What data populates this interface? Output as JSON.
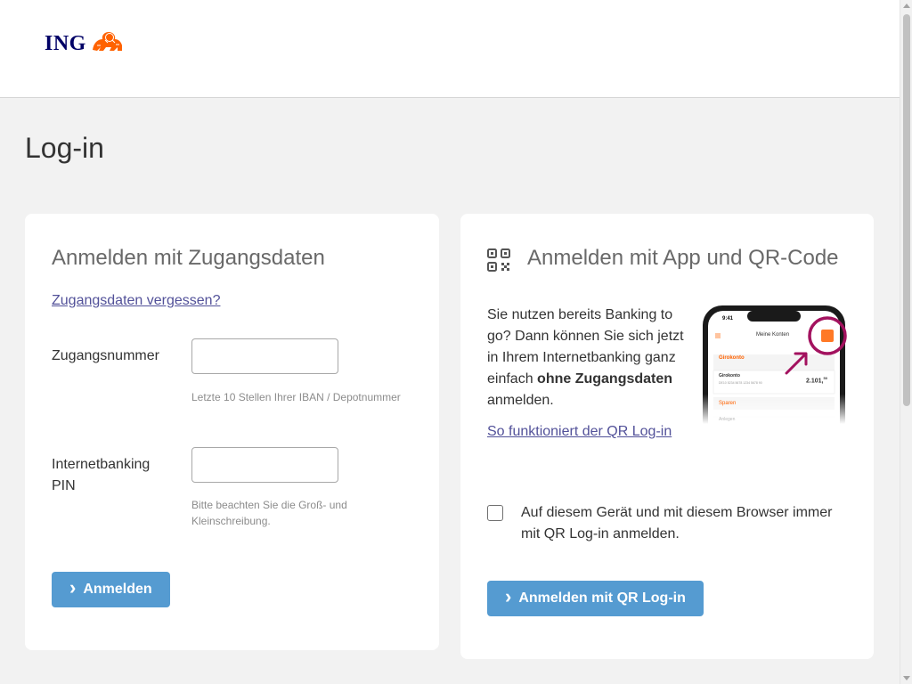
{
  "header": {
    "logo_text": "ING",
    "brand_color": "#000066",
    "lion_color": "#ff6200"
  },
  "page": {
    "title": "Log-in"
  },
  "credentials": {
    "title": "Anmelden mit Zugangsdaten",
    "forgot_link": "Zugangsdaten vergessen?",
    "access_number_label": "Zugangsnummer",
    "access_number_value": "",
    "access_number_hint": "Letzte 10 Stellen Ihrer IBAN / Depotnummer",
    "pin_label_line1": "Internetbanking",
    "pin_label_line2": "PIN",
    "pin_value": "",
    "pin_hint_line1": "Bitte beachten Sie die Groß- und",
    "pin_hint_line2": "Kleinschreibung.",
    "submit_label": "Anmelden"
  },
  "qr": {
    "title": "Anmelden mit App und QR-Code",
    "text_line1": "Sie nutzen bereits Banking to",
    "text_line2": "go? Dann können Sie sich jetzt",
    "text_line3": "in Ihrem Internetbanking ganz",
    "text_line4_prefix": "einfach ",
    "text_line4_bold": "ohne Zugangsdaten",
    "text_line5": "anmelden.",
    "how_link": "So funktioniert der QR Log-in",
    "checkbox_line1": "Auf diesem Gerät und mit diesem Browser immer",
    "checkbox_line2": "mit QR Log-in anmelden.",
    "checkbox_checked": false,
    "submit_label": "Anmelden mit QR Log-in",
    "phone": {
      "time": "9:41",
      "screen_title": "Meine Konten",
      "row1_label": "Girokonto",
      "row1_amount": "2.101,",
      "row1_amount_cents": "50",
      "row1_small": "DE10 5234 5678 1234 5678 90",
      "row2_label": "Girokonto",
      "row2_value": "2.101,",
      "row3_label": "Sparen",
      "row4_label": "Anlegen"
    }
  },
  "colors": {
    "button": "#559bd1",
    "link": "#525199",
    "qr_accent": "#a3125f"
  }
}
